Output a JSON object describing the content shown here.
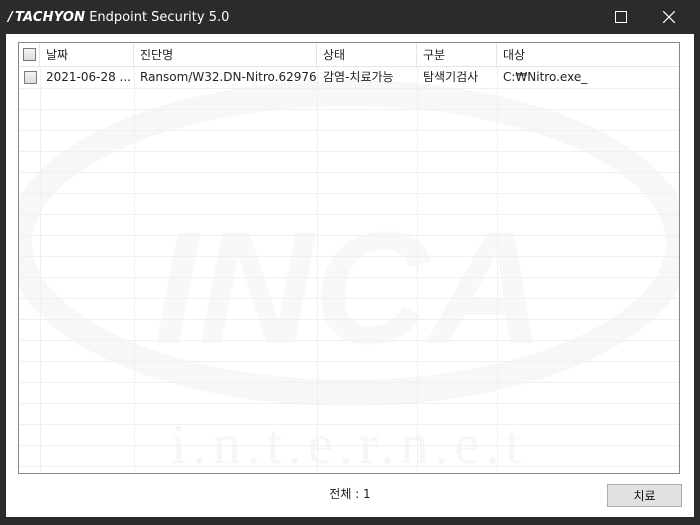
{
  "window": {
    "brand": "TACHYON",
    "title": "Endpoint Security 5.0",
    "icons": {
      "maximize": "maximize-icon",
      "close": "close-icon"
    }
  },
  "watermark": {
    "logo_text": "INCA",
    "sub_text": "i.n.t.e.r.n.e.t"
  },
  "table": {
    "columns": [
      "날짜",
      "진단명",
      "상태",
      "구분",
      "대상"
    ],
    "rows": [
      {
        "date": "2021-06-28 ...",
        "diagnosis": "Ransom/W32.DN-Nitro.62976",
        "status": "감염-치료가능",
        "category": "탐색기검사",
        "target": "C:₩Nitro.exe_",
        "checked": false
      }
    ]
  },
  "footer": {
    "count_text": "전체 : 1",
    "heal_label": "치료"
  }
}
